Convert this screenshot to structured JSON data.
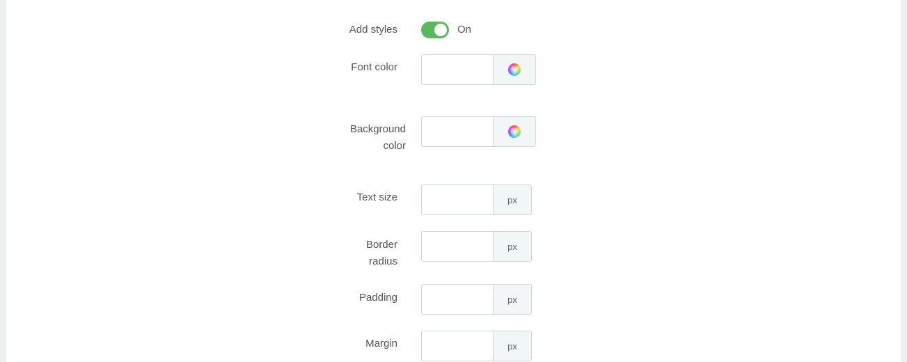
{
  "colors": {
    "toggle_on": "#5cb85c",
    "addon_bg": "#f3f6f7",
    "border": "#cfd8dc"
  },
  "form": {
    "add_styles": {
      "label": "Add styles",
      "state": "On",
      "checked": true
    },
    "font_color": {
      "label": "Font color",
      "value": "",
      "icon": "color-wheel-icon"
    },
    "background_color": {
      "label_line1": "Background",
      "label_line2": "color",
      "value": "",
      "icon": "color-wheel-icon"
    },
    "text_size": {
      "label": "Text size",
      "value": "",
      "unit": "px"
    },
    "border_radius": {
      "label_line1": "Border",
      "label_line2": "radius",
      "value": "",
      "unit": "px"
    },
    "padding": {
      "label": "Padding",
      "value": "",
      "unit": "px"
    },
    "margin": {
      "label": "Margin",
      "value": "",
      "unit": "px"
    }
  }
}
